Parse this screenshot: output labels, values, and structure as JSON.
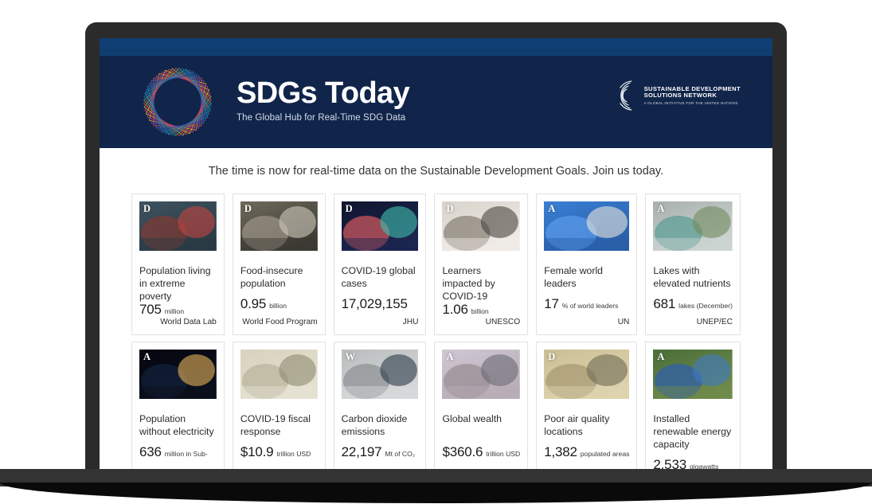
{
  "header": {
    "brand_title": "SDGs Today",
    "brand_subtitle": "The Global Hub for Real-Time SDG Data",
    "sdsn_line1": "SUSTAINABLE DEVELOPMENT",
    "sdsn_line2": "SOLUTIONS NETWORK",
    "sdsn_line3": "A GLOBAL INITIATIVE FOR THE UNITED NATIONS",
    "navbar_color": "#0f3f72",
    "header_color": "#11254a"
  },
  "main": {
    "tagline": "The time is now for real-time data on the Sustainable Development Goals. Join us today.",
    "cards": [
      {
        "badge": "D",
        "title": "Population living in extreme poverty",
        "value": "705",
        "unit": "million",
        "source": "World Data Lab",
        "image": "woman-with-child-poverty"
      },
      {
        "badge": "D",
        "title": "Food-insecure population",
        "value": "0.95",
        "unit": "billion",
        "source": "World Food Program",
        "image": "person-carrying-sack-food-aid"
      },
      {
        "badge": "D",
        "title": "COVID-19 global cases",
        "value": "17,029,155",
        "unit": "",
        "source": "JHU",
        "image": "coronavirus-particle-micrograph"
      },
      {
        "badge": "D",
        "title": "Learners impacted by COVID-19",
        "value": "1.06",
        "unit": "billion",
        "source": "UNESCO",
        "image": "student-at-laptop-remote-learning"
      },
      {
        "badge": "A",
        "title": "Female world leaders",
        "value": "17",
        "unit": "% of world leaders",
        "source": "UN",
        "image": "two-female-leaders-at-podiums"
      },
      {
        "badge": "A",
        "title": "Lakes with elevated nutrients",
        "value": "681",
        "unit": "lakes (December)",
        "source": "UNEP/EC",
        "image": "mountain-lake-landscape"
      },
      {
        "badge": "A",
        "title": "Population without electricity",
        "value": "636",
        "unit": "million in Sub-",
        "source": "",
        "image": "earth-at-night-from-space"
      },
      {
        "badge": "",
        "title": "COVID-19 fiscal response",
        "value": "$10.9",
        "unit": "trillion USD",
        "source": "",
        "image": "us-dollar-banknotes"
      },
      {
        "badge": "W",
        "title": "Carbon dioxide emissions",
        "value": "22,197",
        "unit": "Mt of CO₂",
        "source": "",
        "image": "industrial-plant-smokestacks"
      },
      {
        "badge": "A",
        "title": "Global wealth",
        "value": "$360.6",
        "unit": "trillion USD",
        "source": "",
        "image": "city-buildings-skyline"
      },
      {
        "badge": "D",
        "title": "Poor air quality locations",
        "value": "1,382",
        "unit": "populated areas",
        "source": "",
        "image": "smoggy-city-skyline"
      },
      {
        "badge": "A",
        "title": "Installed renewable energy capacity",
        "value": "2,533",
        "unit": "gigawatts",
        "source": "",
        "image": "solar-panel-farm-aerial"
      }
    ]
  }
}
